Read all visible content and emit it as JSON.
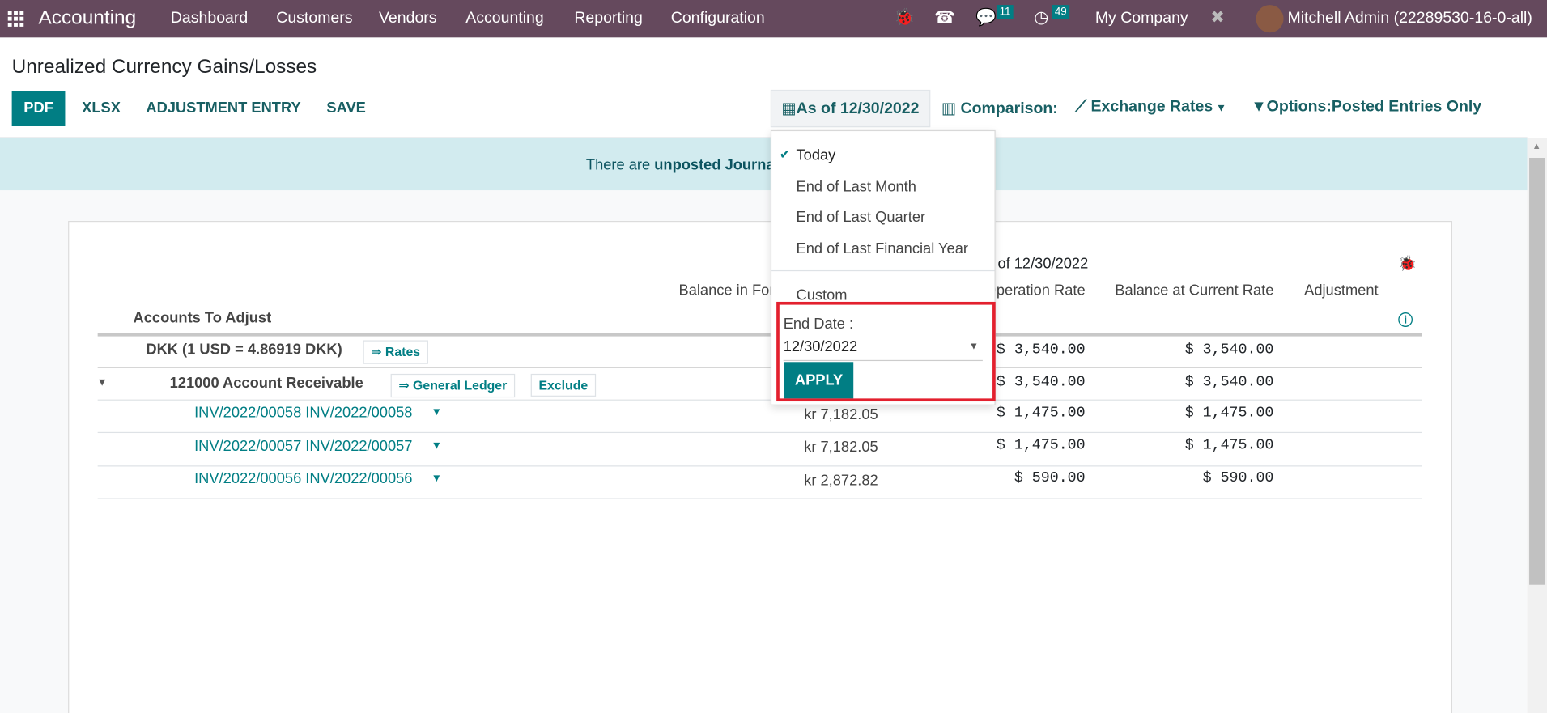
{
  "navbar": {
    "app_name": "Accounting",
    "menu": [
      "Dashboard",
      "Customers",
      "Vendors",
      "Accounting",
      "Reporting",
      "Configuration"
    ],
    "messages_count": "11",
    "activities_count": "49",
    "company": "My Company",
    "user": "Mitchell Admin (22289530-16-0-all)",
    "color": "#65495d"
  },
  "page": {
    "title": "Unrealized Currency Gains/Losses"
  },
  "toolbar": {
    "pdf": "PDF",
    "xlsx": "XLSX",
    "adjustment": "ADJUSTMENT ENTRY",
    "save": "SAVE"
  },
  "filters": {
    "date": "As of 12/30/2022",
    "comparison": "Comparison:",
    "exchange": "Exchange Rates",
    "options": "Options:Posted Entries Only"
  },
  "banner": {
    "prefix": "There are ",
    "link": "unposted Journal Entries"
  },
  "date_menu": {
    "items": [
      "Today",
      "End of Last Month",
      "End of Last Quarter",
      "End of Last Financial Year"
    ],
    "selected": "Today",
    "custom": "Custom",
    "end_date_label": "End Date :",
    "end_date_value": "12/30/2022",
    "apply": "APPLY"
  },
  "table": {
    "period_header": "As of 12/30/2022",
    "columns": [
      "Accounts To Adjust",
      "Balance in Foreign Currency",
      "Balance at Operation Rate",
      "Balance at Current Rate",
      "Adjustment"
    ],
    "currency_row": {
      "label": "DKK (1 USD = 4.86919 DKK)",
      "rates_btn": "⇒ Rates",
      "operation": "$ 3,540.00",
      "current": "$ 3,540.00"
    },
    "account_row": {
      "label": "121000 Account Receivable",
      "ledger_btn": "⇒ General Ledger",
      "exclude_btn": "Exclude",
      "operation": "$ 3,540.00",
      "current": "$ 3,540.00"
    },
    "rows": [
      {
        "name": "INV/2022/00058 INV/2022/00058",
        "foreign": "kr 7,182.05",
        "operation": "$ 1,475.00",
        "current": "$ 1,475.00"
      },
      {
        "name": "INV/2022/00057 INV/2022/00057",
        "foreign": "kr 7,182.05",
        "operation": "$ 1,475.00",
        "current": "$ 1,475.00"
      },
      {
        "name": "INV/2022/00056 INV/2022/00056",
        "foreign": "kr 2,872.82",
        "operation": "$ 590.00",
        "current": "$ 590.00"
      }
    ]
  },
  "accent": "#017e84"
}
